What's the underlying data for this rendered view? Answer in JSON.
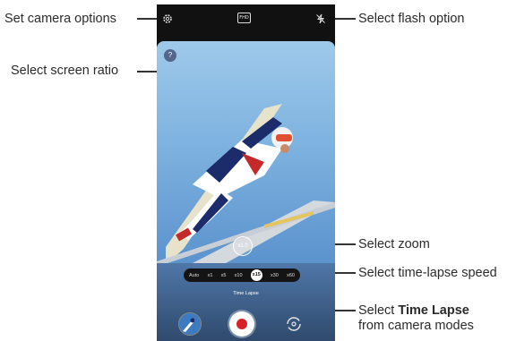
{
  "callouts": {
    "set_camera_options": "Set camera options",
    "select_flash_option": "Select flash option",
    "select_screen_ratio": "Select screen ratio",
    "select_zoom": "Select zoom",
    "select_timelapse_speed": "Select time-lapse speed",
    "select_timelapse_prefix": "Select ",
    "select_timelapse_bold": "Time Lapse",
    "select_timelapse_line2": "from camera modes"
  },
  "camera": {
    "settings_icon": "gear-icon",
    "flash_icon": "flash-off-icon",
    "ratio_badge": "FHD",
    "help_button": "?",
    "zoom_value": "x1.0",
    "speeds": [
      "Auto",
      "x1",
      "x5",
      "x10",
      "x15",
      "x30",
      "x60"
    ],
    "selected_speed": "x15",
    "modes": [
      "Time Lapse"
    ],
    "active_mode": "Time Lapse",
    "gallery_icon": "gallery-thumbnail",
    "record_icon": "record-icon",
    "switch_icon": "camera-switch-icon",
    "accent_record": "#d8202a",
    "sky_color": "#7fb3e0"
  }
}
